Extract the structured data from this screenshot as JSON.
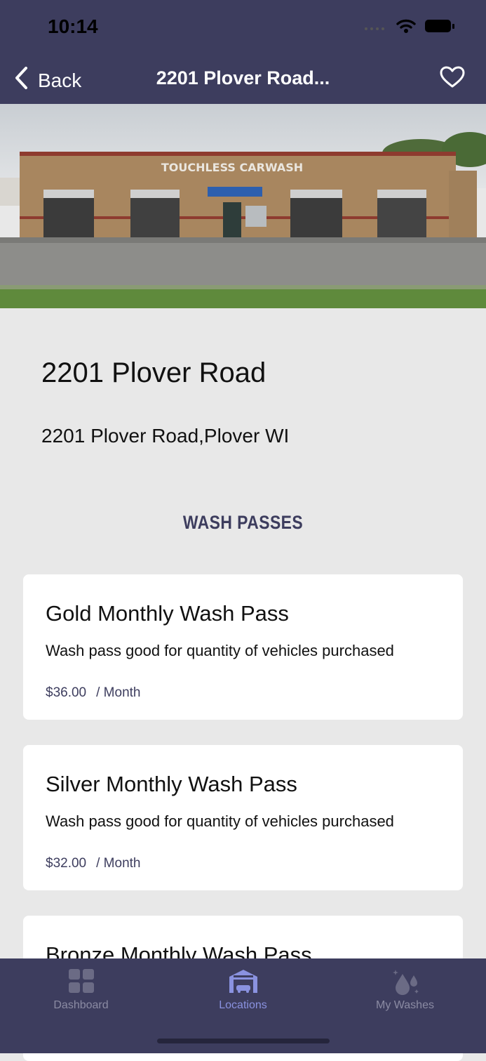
{
  "status_bar": {
    "time": "10:14"
  },
  "nav": {
    "back_label": "Back",
    "title": "2201 Plover Road..."
  },
  "hero": {
    "sign_text": "TOUCHLESS CARWASH"
  },
  "location": {
    "name": "2201 Plover Road",
    "address": "2201 Plover Road,Plover WI"
  },
  "wash_passes": {
    "heading": "WASH PASSES",
    "items": [
      {
        "name": "Gold Monthly Wash Pass",
        "description": "Wash pass good for quantity of vehicles purchased",
        "price": "$36.00",
        "period": "/ Month"
      },
      {
        "name": "Silver Monthly Wash Pass",
        "description": "Wash pass good for quantity of vehicles purchased",
        "price": "$32.00",
        "period": "/ Month"
      },
      {
        "name": "Bronze Monthly Wash Pass"
      }
    ]
  },
  "tab_bar": {
    "tabs": [
      {
        "label": "Dashboard",
        "icon": "grid-icon"
      },
      {
        "label": "Locations",
        "icon": "carwash-building-icon",
        "active": true
      },
      {
        "label": "My Washes",
        "icon": "water-drops-icon"
      }
    ]
  },
  "colors": {
    "nav_bg": "#3d3d5e",
    "active_tab": "#8a92e0",
    "inactive_tab": "#8b8ba3",
    "page_bg": "#e8e8e8"
  }
}
